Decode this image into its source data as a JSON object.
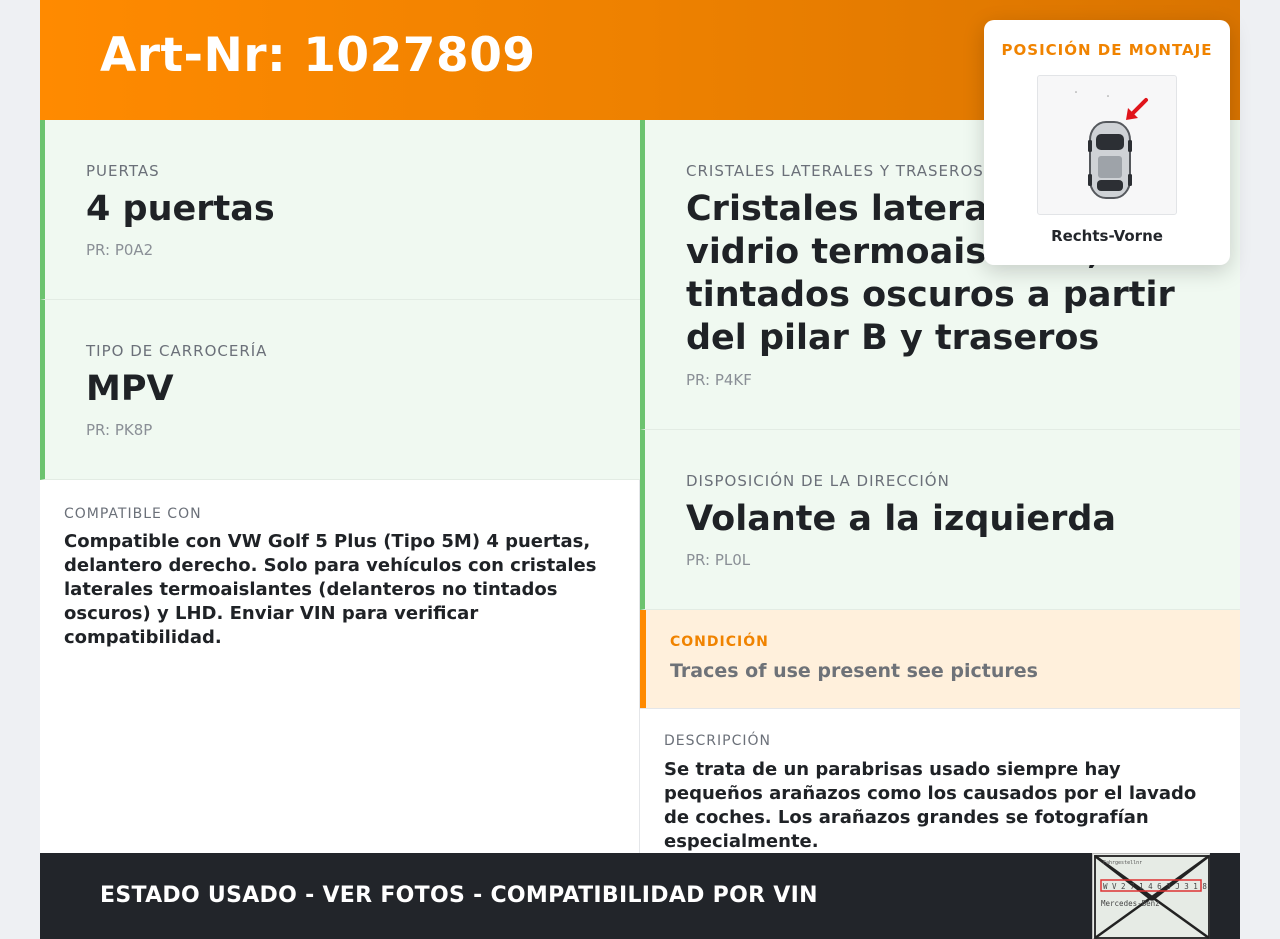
{
  "header": {
    "title": "Art-Nr: 1027809"
  },
  "specs": [
    {
      "label": "PUERTAS",
      "value": "4 puertas",
      "code": "PR: P0A2"
    },
    {
      "label": "TIPO DE CARROCERÍA",
      "value": "MPV",
      "code": "PR: PK8P"
    },
    {
      "label": "CRISTALES LATERALES Y TRASEROS",
      "value": "Cristales laterales de vidrio termoaislante, tintados oscuros a partir del pilar B y traseros",
      "code": "PR: P4KF"
    },
    {
      "label": "DISPOSICIÓN DE LA DIRECCIÓN",
      "value": "Volante a la izquierda",
      "code": "PR: PL0L"
    }
  ],
  "compatible": {
    "label": "COMPATIBLE CON",
    "text": "Compatible con VW Golf 5 Plus (Tipo 5M) 4 puertas, delantero derecho. Solo para vehículos con cristales laterales termoaislantes (delanteros no tintados oscuros) y LHD. Enviar VIN para verificar compatibilidad."
  },
  "condition": {
    "label": "CONDICIÓN",
    "text": "Traces of use present see pictures"
  },
  "description": {
    "label": "DESCRIPCIÓN",
    "text": "Se trata de un parabrisas usado siempre hay pequeños arañazos como los causados por el lavado de coches. Los arañazos grandes se fotografían especialmente."
  },
  "mount": {
    "title": "POSICIÓN DE MONTAJE",
    "caption": "Rechts-Vorne"
  },
  "footer": {
    "text": "ESTADO USADO - VER FOTOS - COMPATIBILIDAD POR VIN"
  },
  "stamp": {
    "line1": "Fahrgestellnr",
    "line2": "W V 2 7 1 4 6 3 J 3 1 8 7",
    "line3": "Mercedes-Benz"
  },
  "colors": {
    "accent": "#ff8a00",
    "spec_border": "#6cc36f",
    "spec_bg": "#f0f9f1",
    "footer_bg": "#22252a",
    "condition_bg": "#fff0dc"
  }
}
